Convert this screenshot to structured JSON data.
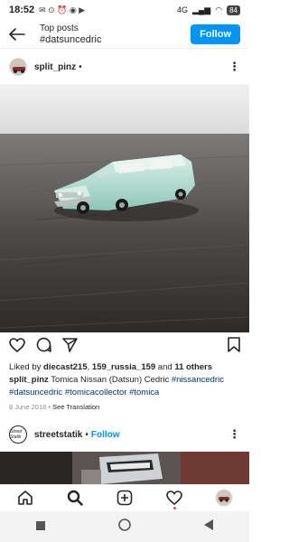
{
  "status": {
    "time": "18:52",
    "network": "4G",
    "battery": "84"
  },
  "header": {
    "title": "Top posts",
    "hashtag": "#datsuncedric",
    "follow_label": "Follow"
  },
  "post": {
    "username": "split_pinz",
    "dot": "•",
    "likes_prefix": "Liked by ",
    "liker1": "diecast215",
    "liker_sep": ", ",
    "liker2": "159_russia_159",
    "likes_and": " and ",
    "others": "11 others",
    "caption_user": "split_pinz",
    "caption_text": " Tomica Nissan (Datsun) Cedric ",
    "tags": [
      "#nissancedric",
      "#datsuncedric",
      "#tomicacollector",
      "#tomica"
    ],
    "date": "8 June 2018",
    "see_translation": "See Translation"
  },
  "next_post": {
    "username": "streetstatik",
    "dot": "•",
    "follow_label": "Follow",
    "avatar_text": "Street Statik"
  },
  "nav": [
    "home-icon",
    "search-icon",
    "new-post-icon",
    "activity-icon",
    "profile-icon"
  ],
  "colors": {
    "accent": "#0095f6",
    "link": "#00376b",
    "muted": "#8e8e8e"
  }
}
